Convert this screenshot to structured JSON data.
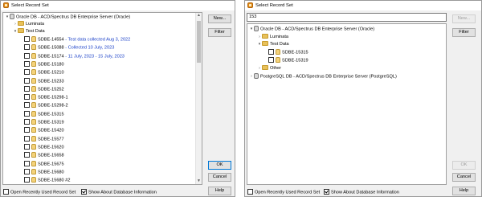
{
  "dialog1": {
    "title": "Select Record Set",
    "buttons": {
      "new": "New...",
      "filter": "Filter",
      "ok": "OK",
      "cancel": "Cancel",
      "help": "Help"
    },
    "bottom": {
      "recent": "Open Recently Used Record Set",
      "show_about": "Show About Database Information"
    },
    "tree": {
      "root": "Oracle DB   - ACD/Spectrus DB Enterprise Server (Oracle)",
      "luminata": "Luminata",
      "test_data": "Test Data",
      "records": [
        {
          "name": "SDBE-14554",
          "desc": "- Test data collected Aug 3, 2022"
        },
        {
          "name": "SDBE-15088",
          "desc": "- Collected 10 July, 2023"
        },
        {
          "name": "SDBE-15174",
          "desc": "- 11 July, 2023 - 15 July, 2023"
        },
        {
          "name": "SDBE-15180",
          "desc": ""
        },
        {
          "name": "SDBE-15210",
          "desc": ""
        },
        {
          "name": "SDBE-15233",
          "desc": ""
        },
        {
          "name": "SDBE-15252",
          "desc": ""
        },
        {
          "name": "SDBE-15298-1",
          "desc": ""
        },
        {
          "name": "SDBE-15298-2",
          "desc": ""
        },
        {
          "name": "SDBE-15315",
          "desc": ""
        },
        {
          "name": "SDBE-15319",
          "desc": ""
        },
        {
          "name": "SDBE-15420",
          "desc": ""
        },
        {
          "name": "SDBE-15577",
          "desc": ""
        },
        {
          "name": "SDBE-15620",
          "desc": ""
        },
        {
          "name": "SDBE-15658",
          "desc": ""
        },
        {
          "name": "SDBE-15675",
          "desc": ""
        },
        {
          "name": "SDBE-15680",
          "desc": ""
        },
        {
          "name": "SDBE-15680 #2",
          "desc": ""
        }
      ]
    }
  },
  "dialog2": {
    "title": "Select Record Set",
    "search_value": "153",
    "buttons": {
      "new": "New...",
      "filter": "Filter",
      "ok": "OK",
      "cancel": "Cancel",
      "help": "Help"
    },
    "bottom": {
      "recent": "Open Recently Used Record Set",
      "show_about": "Show About Database Information"
    },
    "tree": {
      "root": "Oracle DB   - ACD/Spectrus DB Enterprise Server (Oracle)",
      "luminata": "Luminata",
      "test_data": "Test Data",
      "records": [
        "SDBE-15315",
        "SDBE-15319"
      ],
      "other": "Other",
      "postgres": "PostgreSQL DB   - ACD/Spectrus DB Enterprise Server (PostgreSQL)"
    }
  }
}
